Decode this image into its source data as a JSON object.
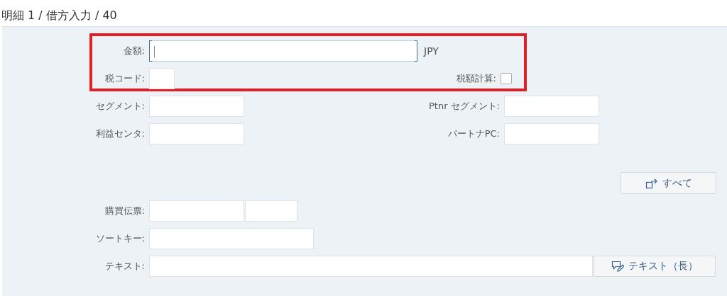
{
  "title": "明細 1 / 借方入力 / 40",
  "amount": {
    "label": "金額:",
    "currency": "JPY",
    "focused": true
  },
  "tax_code": {
    "label": "税コード:"
  },
  "tax_calculation": {
    "label": "税額計算:",
    "checked": false
  },
  "segment": {
    "label": "セグメント:"
  },
  "partner_segment": {
    "label": "Ptnr セグメント:"
  },
  "profit_center": {
    "label": "利益センタ:"
  },
  "partner_pc": {
    "label": "パートナPC:"
  },
  "all_button": {
    "label": "すべて"
  },
  "purchasing_document": {
    "label": "購買伝票:"
  },
  "sort_key": {
    "label": "ソートキー:"
  },
  "text": {
    "label": "テキスト:"
  },
  "long_text_button": {
    "label": "テキスト（長）"
  }
}
